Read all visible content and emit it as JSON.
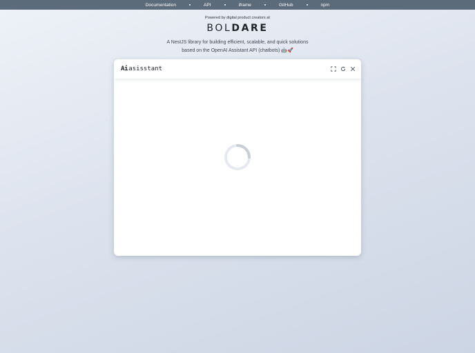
{
  "nav": {
    "links": [
      "Documentation",
      "API",
      "iframe",
      "GitHub",
      "npm"
    ]
  },
  "hero": {
    "powered_by": "Powered by digital product creators at",
    "brand_light": "BOL",
    "brand_bold": "DARE",
    "tagline_line1": "A NestJS library for building efficient, scalable, and quick solutions",
    "tagline_line2": "based on the OpenAI Assistant API (chatbots) 🤖🚀"
  },
  "chat": {
    "logo_mark": "Ai",
    "logo_text": "asisstant",
    "icons": [
      "fullscreen-icon",
      "refresh-icon",
      "close-icon"
    ],
    "state": "loading"
  },
  "colors": {
    "nav_bg": "#5c6b7a",
    "nav_text": "#ffffff",
    "spinner_track": "#e6eaf0",
    "spinner_arc": "#c9ced6"
  }
}
